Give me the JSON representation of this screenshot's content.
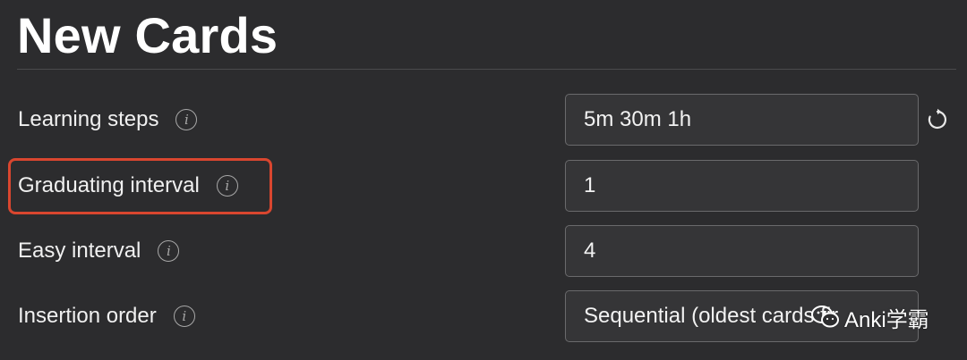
{
  "section": {
    "title": "New Cards"
  },
  "rows": [
    {
      "label": "Learning steps",
      "value": "5m 30m 1h"
    },
    {
      "label": "Graduating interval",
      "value": "1"
    },
    {
      "label": "Easy interval",
      "value": "4"
    },
    {
      "label": "Insertion order",
      "value": "Sequential (oldest cards fir"
    }
  ],
  "icons": {
    "info": "i",
    "revert": "revert-icon"
  },
  "watermark": {
    "text": "Anki学霸"
  },
  "colors": {
    "background": "#2c2c2e",
    "highlight": "#d9462f",
    "field_border": "#6a6a6c"
  }
}
